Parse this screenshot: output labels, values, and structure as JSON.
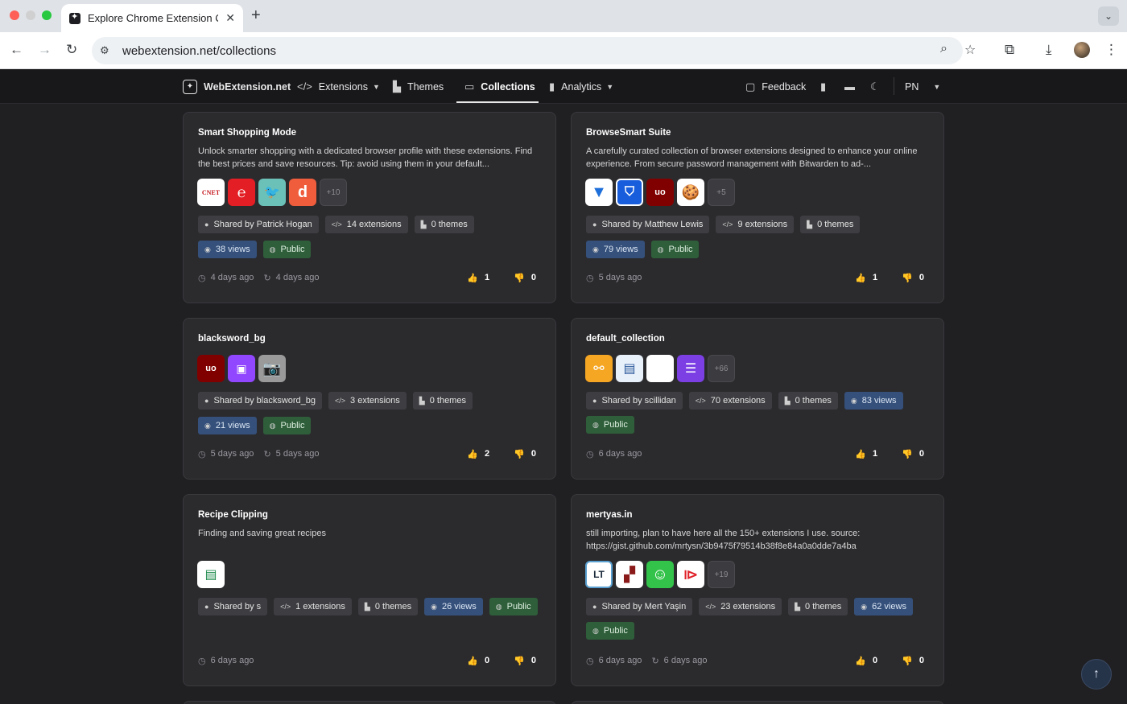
{
  "browser": {
    "tab_title": "Explore Chrome Extension Co",
    "tab_close": "✕",
    "new_tab": "+",
    "url": "webextension.net/collections",
    "traffic_colors": [
      "#fe5f57",
      "#febc2e",
      "#28c840"
    ]
  },
  "nav": {
    "brand": "WebExtension.net",
    "extensions": "Extensions",
    "themes": "Themes",
    "collections": "Collections",
    "analytics": "Analytics",
    "feedback": "Feedback",
    "lang": "PN"
  },
  "collections": [
    {
      "title": "Smart Shopping Mode",
      "desc": "Unlock smarter shopping with a dedicated browser profile with these extensions. Find the best prices and save resources. Tip: avoid using them in your default...",
      "icons": [
        "cnet-shopping-icon",
        "rakuten-icon",
        "bird-icon",
        "dealspotr-icon"
      ],
      "more": "+10",
      "shared": "Shared by Patrick Hogan",
      "extensions": "14 extensions",
      "themes": "0 themes",
      "views": "38 views",
      "visibility": "Public",
      "created": "4 days ago",
      "updated": "4 days ago",
      "likes": "1",
      "dislikes": "0"
    },
    {
      "title": "BrowseSmart Suite",
      "desc": "A carefully curated collection of browser extensions designed to enhance your online experience. From secure password management with Bitwarden to ad-...",
      "icons": [
        "funnel-icon",
        "bitwarden-icon",
        "ublock-icon",
        "cookie-icon"
      ],
      "more": "+5",
      "shared": "Shared by Matthew Lewis",
      "extensions": "9 extensions",
      "themes": "0 themes",
      "views": "79 views",
      "visibility": "Public",
      "created": "5 days ago",
      "likes": "1",
      "dislikes": "0"
    },
    {
      "title": "blacksword_bg",
      "icons": [
        "ublock-icon",
        "twitch-icon",
        "camera-icon"
      ],
      "shared": "Shared by blacksword_bg",
      "extensions": "3 extensions",
      "themes": "0 themes",
      "views": "21 views",
      "visibility": "Public",
      "created": "5 days ago",
      "updated": "5 days ago",
      "likes": "2",
      "dislikes": "0"
    },
    {
      "title": "default_collection",
      "icons": [
        "share-node-icon",
        "browser-window-icon",
        "monkey-icon",
        "list-icon"
      ],
      "more": "+66",
      "shared": "Shared by scillidan",
      "extensions": "70 extensions",
      "themes": "0 themes",
      "views": "83 views",
      "visibility": "Public",
      "created": "6 days ago",
      "likes": "1",
      "dislikes": "0"
    },
    {
      "title": "Recipe Clipping",
      "desc": "Finding and saving great recipes",
      "icons": [
        "recipe-card-icon"
      ],
      "shared": "Shared by s",
      "extensions": "1 extensions",
      "themes": "0 themes",
      "views": "26 views",
      "visibility": "Public",
      "created": "6 days ago",
      "likes": "0",
      "dislikes": "0"
    },
    {
      "title": "mertyas.in",
      "desc": "still importing, plan to have here all the 150+ extensions I use. source: https://gist.github.com/mrtysn/3b9475f79514b38f8e84a0a0dde7a4ba",
      "icons": [
        "languagetool-icon",
        "book-icon",
        "smiley-icon",
        "red-arrow-icon"
      ],
      "more": "+19",
      "shared": "Shared by Mert Yaşin",
      "extensions": "23 extensions",
      "themes": "0 themes",
      "views": "62 views",
      "visibility": "Public",
      "created": "6 days ago",
      "updated": "6 days ago",
      "likes": "0",
      "dislikes": "0"
    }
  ]
}
